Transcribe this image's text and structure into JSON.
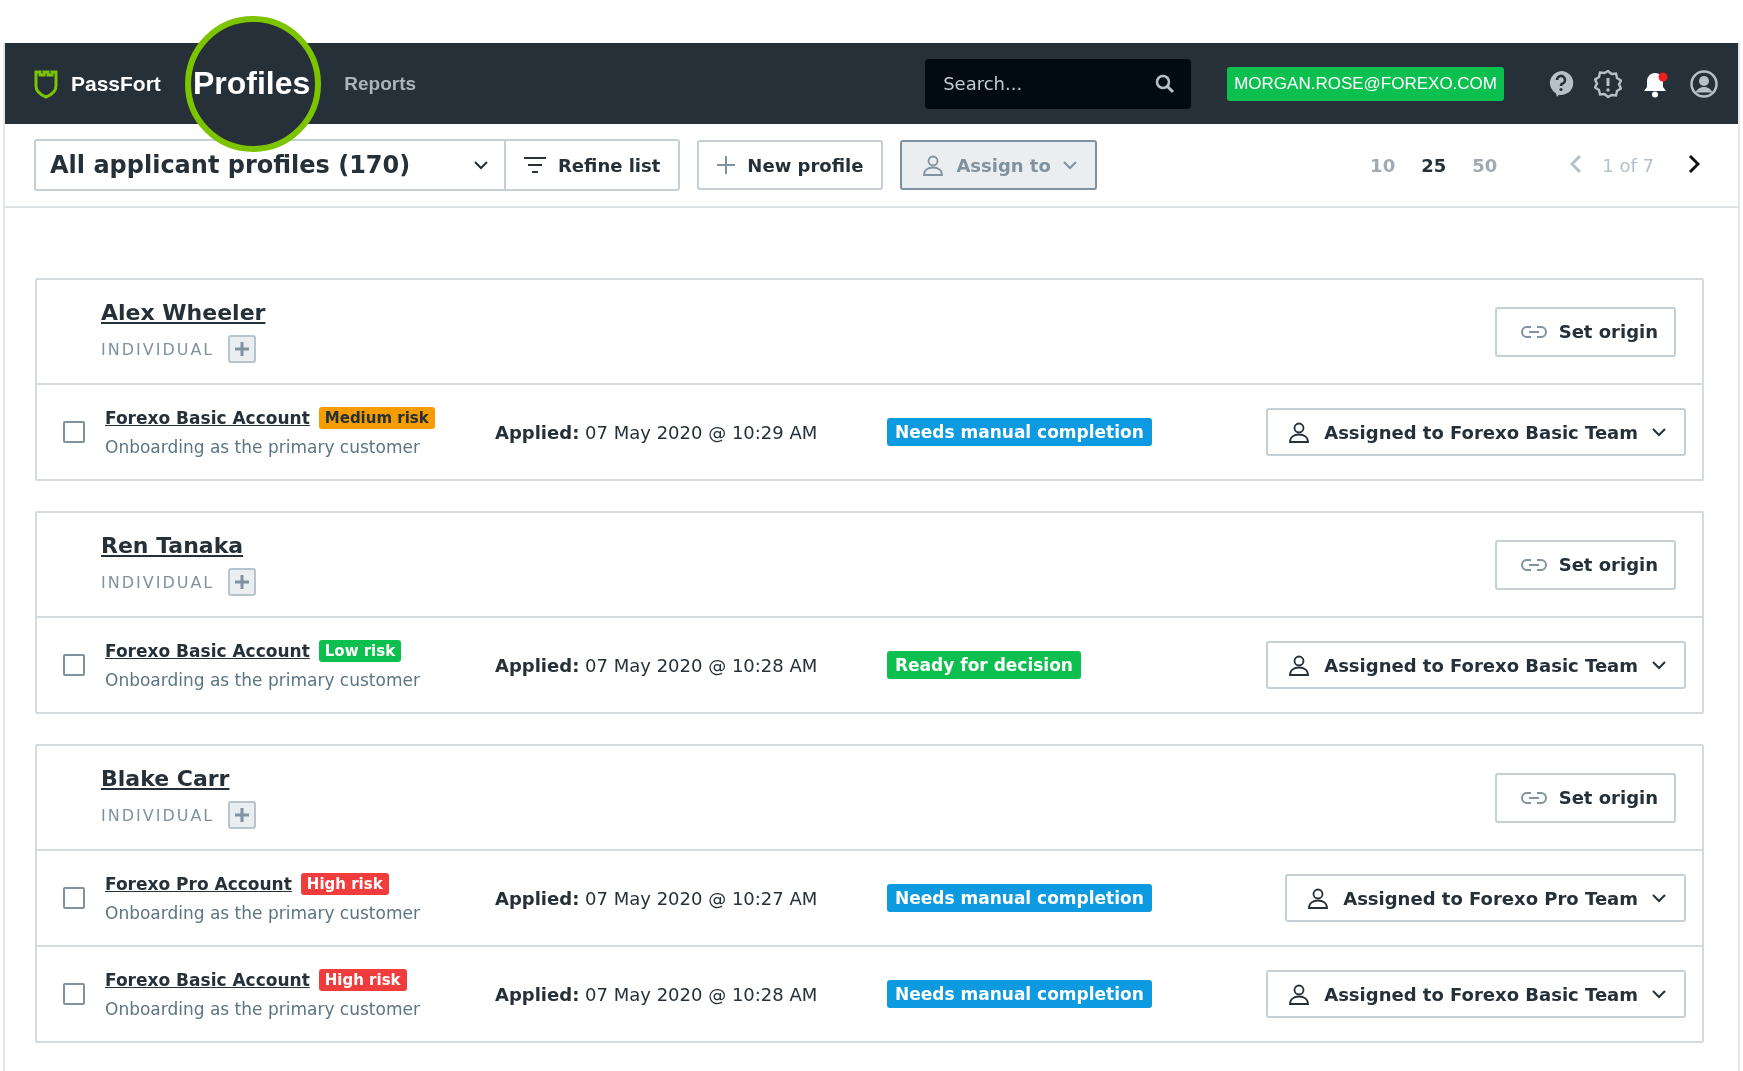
{
  "header": {
    "brand": "PassFort",
    "nav": [
      {
        "label": "Profiles",
        "selected": true
      },
      {
        "label": "Reports",
        "selected": false
      }
    ],
    "search": {
      "placeholder": "Search..."
    },
    "user_email": "MORGAN.ROSE@FOREXO.COM"
  },
  "toolbar": {
    "list_filter": "All applicant profiles (170)",
    "refine": "Refine list",
    "new_profile": "New profile",
    "assign": "Assign to",
    "page_sizes": [
      {
        "label": "10",
        "selected": false
      },
      {
        "label": "25",
        "selected": true
      },
      {
        "label": "50",
        "selected": false
      }
    ],
    "pagination": "1 of 7"
  },
  "profiles": [
    {
      "name": "Alex Wheeler",
      "type": "INDIVIDUAL",
      "set_origin": "Set origin",
      "applications": [
        {
          "checked": false,
          "product": "Forexo Basic Account",
          "risk": {
            "label": "Medium risk",
            "color": "#f59c00"
          },
          "subtitle": "Onboarding as the primary customer",
          "applied_label": "Applied:",
          "applied_value": "07 May 2020 @ 10:29 AM",
          "status": {
            "label": "Needs manual completion",
            "color": "#0d9ae0"
          },
          "assignee": "Assigned to Forexo Basic Team"
        }
      ]
    },
    {
      "name": "Ren Tanaka",
      "type": "INDIVIDUAL",
      "set_origin": "Set origin",
      "applications": [
        {
          "checked": false,
          "product": "Forexo Basic Account",
          "risk": {
            "label": "Low risk",
            "color": "#0cc04f"
          },
          "subtitle": "Onboarding as the primary customer",
          "applied_label": "Applied:",
          "applied_value": "07 May 2020 @ 10:28 AM",
          "status": {
            "label": "Ready for decision",
            "color": "#0cc04f"
          },
          "assignee": "Assigned to Forexo Basic Team"
        }
      ]
    },
    {
      "name": "Blake Carr",
      "type": "INDIVIDUAL",
      "set_origin": "Set origin",
      "applications": [
        {
          "checked": false,
          "product": "Forexo Pro Account",
          "risk": {
            "label": "High risk",
            "color": "#f03c3c"
          },
          "subtitle": "Onboarding as the primary customer",
          "applied_label": "Applied:",
          "applied_value": "07 May 2020 @ 10:27 AM",
          "status": {
            "label": "Needs manual completion",
            "color": "#0d9ae0"
          },
          "assignee": "Assigned to Forexo Pro Team"
        },
        {
          "checked": false,
          "product": "Forexo Basic Account",
          "risk": {
            "label": "High risk",
            "color": "#f03c3c"
          },
          "subtitle": "Onboarding as the primary customer",
          "applied_label": "Applied:",
          "applied_value": "07 May 2020 @ 10:28 AM",
          "status": {
            "label": "Needs manual completion",
            "color": "#0d9ae0"
          },
          "assignee": "Assigned to Forexo Basic Team"
        }
      ]
    }
  ]
}
